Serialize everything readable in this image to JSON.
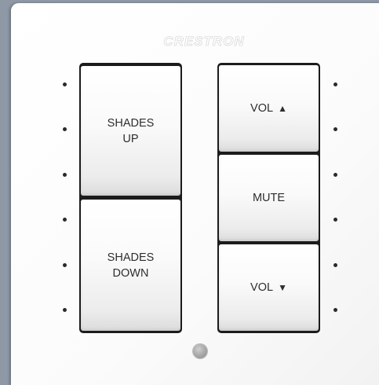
{
  "panel": {
    "brand": "CRESTRON"
  },
  "buttons": {
    "shades_up": "SHADES\nUP",
    "shades_down": "SHADES\nDOWN",
    "vol_up": "VOL",
    "vol_up_arrow": "▲",
    "mute": "MUTE",
    "vol_down": "VOL",
    "vol_down_arrow": "▼"
  }
}
